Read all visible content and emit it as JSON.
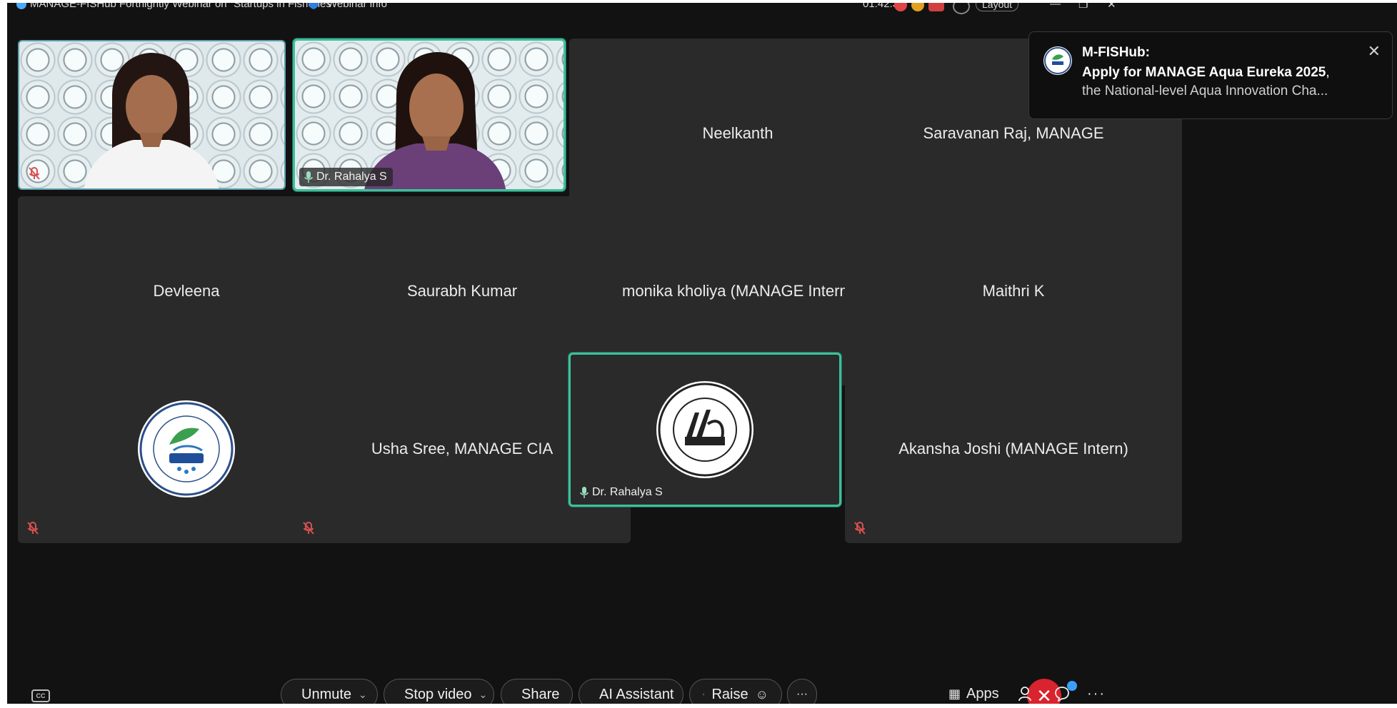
{
  "window": {
    "title": "MANAGE-FISHub Fortnightly Webinar on \"Startups in Fisheries\"",
    "webinar_info": "Webinar info",
    "timer": "01:42:39",
    "layout_label": "Layout"
  },
  "colors": {
    "background": "#121212",
    "tile": "#2a2a2a",
    "active_border": "#3fbf9a",
    "end_call": "#d9232e",
    "badge": "#3aa0ff",
    "muted_icon": "#d85050"
  },
  "tiles": [
    {
      "name": "",
      "type": "video",
      "muted": true
    },
    {
      "name": "Dr. Rahalya S",
      "type": "video",
      "muted": false,
      "active": true
    },
    {
      "name": "Neelkanth",
      "type": "name",
      "muted": false
    },
    {
      "name": "Saravanan Raj, MANAGE",
      "type": "name",
      "muted": false
    },
    {
      "name": "Devleena",
      "type": "name",
      "muted": true
    },
    {
      "name": "Saurabh Kumar",
      "type": "name",
      "muted": true
    },
    {
      "name": "monika kholiya (MANAGE Intern)",
      "type": "name",
      "muted": true
    },
    {
      "name": "Maithri K",
      "type": "name",
      "muted": true
    },
    {
      "name": "",
      "type": "logo",
      "logo": "M-FISHub",
      "muted": true
    },
    {
      "name": "Usha Sree, MANAGE CIA",
      "type": "name",
      "muted": true
    },
    {
      "name": "Dr. Rahalya S",
      "type": "logo",
      "logo": "MANAGE",
      "muted": false,
      "active": true
    },
    {
      "name": "Akansha Joshi (MANAGE Intern)",
      "type": "name",
      "muted": true
    }
  ],
  "notification": {
    "title": "M-FISHub:",
    "line1_bold": "Apply for MANAGE Aqua Eureka 2025",
    "line1_rest": ",",
    "line2": "the National-level Aqua Innovation Cha..."
  },
  "toolbar": {
    "unmute": "Unmute",
    "stop_video": "Stop video",
    "share": "Share",
    "ai_assistant": "AI Assistant",
    "raise": "Raise",
    "apps": "Apps",
    "more": "···",
    "end": "✕",
    "cc": "CC"
  }
}
